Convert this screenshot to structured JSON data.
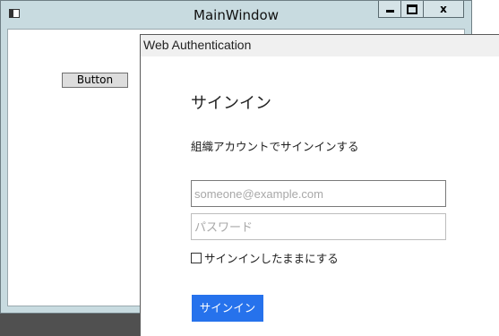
{
  "main_window": {
    "title": "MainWindow",
    "button_label": "Button",
    "controls": {
      "close_label": "x"
    }
  },
  "web_auth": {
    "title": "Web Authentication",
    "heading": "サインイン",
    "subheading": "組織アカウントでサインインする",
    "email_placeholder": "someone@example.com",
    "password_placeholder": "パスワード",
    "keep_signed_in_label": "サインインしたままにする",
    "keep_signed_in_checked": false,
    "signin_button_label": "サインイン",
    "accent_color": "#2672ec"
  }
}
